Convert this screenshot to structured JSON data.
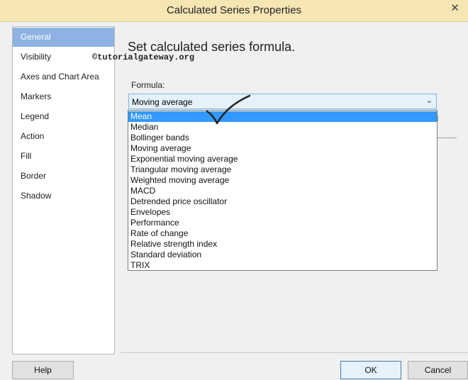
{
  "window": {
    "title": "Calculated Series Properties",
    "close_icon": "close-icon"
  },
  "sidebar": {
    "items": [
      {
        "label": "General",
        "selected": true
      },
      {
        "label": "Visibility"
      },
      {
        "label": "Axes and Chart Area"
      },
      {
        "label": "Markers"
      },
      {
        "label": "Legend"
      },
      {
        "label": "Action"
      },
      {
        "label": "Fill"
      },
      {
        "label": "Border"
      },
      {
        "label": "Shadow"
      }
    ]
  },
  "main": {
    "heading": "Set calculated series formula.",
    "watermark": "©tutorialgateway.org",
    "formula_label": "Formula:",
    "formula_value": "Moving average",
    "formula_options": [
      "Mean",
      "Median",
      "Bollinger bands",
      "Moving average",
      "Exponential moving average",
      "Triangular moving average",
      "Weighted moving average",
      "MACD",
      "Detrended price oscillator",
      "Envelopes",
      "Performance",
      "Rate of change",
      "Relative strength index",
      "Standard deviation",
      "TRIX"
    ],
    "highlighted_option": "Mean"
  },
  "footer": {
    "help_label": "Help",
    "ok_label": "OK",
    "cancel_label": "Cancel"
  },
  "colors": {
    "titlebar": "#f5e6b4",
    "selected_nav": "#8db2e3",
    "highlight": "#3399ff"
  }
}
